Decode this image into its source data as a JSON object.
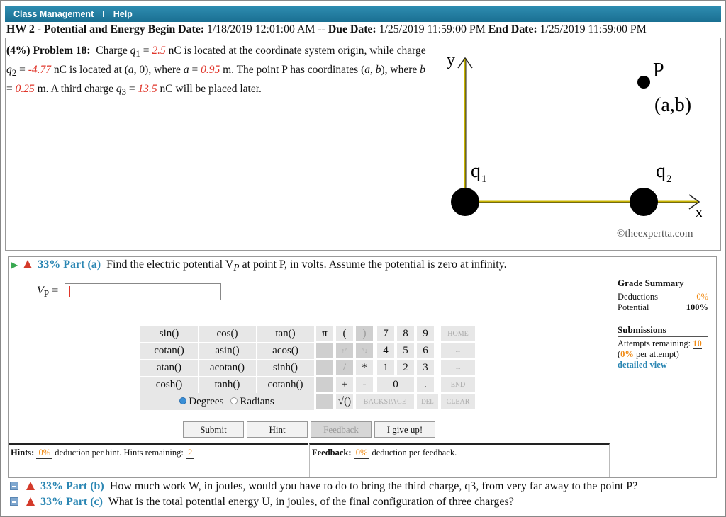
{
  "topbar": {
    "class_management": "Class Management",
    "separator": "I",
    "help": "Help"
  },
  "hw": {
    "title": "HW 2 - Potential and Energy",
    "begin_label": "Begin Date:",
    "begin_value": "1/18/2019 12:01:00 AM --",
    "due_label": "Due Date:",
    "due_value": "1/25/2019 11:59:00 PM",
    "end_label": "End Date:",
    "end_value": "1/25/2019 11:59:00 PM"
  },
  "problem": {
    "header": "(4%)  Problem 18:",
    "q1": "2.5",
    "q2": "-4.77",
    "a": "0.95",
    "b": "0.25",
    "q3": "13.5"
  },
  "figure": {
    "y_label": "y",
    "x_label": "x",
    "p_label": "P",
    "ab_label": "(a,b)",
    "q1_label": "q",
    "q1_sub": "1",
    "q2_label": "q",
    "q2_sub": "2",
    "credit": "©theexpertta.com"
  },
  "part_a": {
    "percent": "33% Part (a)",
    "question": "Find the electric potential V",
    "question_sub": "P",
    "question_rest": " at point P, in volts. Assume the potential is zero at infinity.",
    "answer_label": "V",
    "answer_sub": "P",
    "answer_eq": " =",
    "answer_value": ""
  },
  "calculator": {
    "functions": [
      [
        "sin()",
        "cos()",
        "tan()"
      ],
      [
        "cotan()",
        "asin()",
        "acos()"
      ],
      [
        "atan()",
        "acotan()",
        "sinh()"
      ],
      [
        "cosh()",
        "tanh()",
        "cotanh()"
      ]
    ],
    "degrees": "Degrees",
    "radians": "Radians",
    "angle_mode": "Degrees",
    "keys": {
      "pi": "π",
      "lparen": "(",
      "rparen": ")",
      "up": "↑^",
      "down": "^↓",
      "slash": "/",
      "star": "*",
      "plus": "+",
      "minus": "-",
      "sqrt": "√()",
      "n7": "7",
      "n8": "8",
      "n9": "9",
      "n4": "4",
      "n5": "5",
      "n6": "6",
      "n1": "1",
      "n2": "2",
      "n3": "3",
      "n0": "0",
      "dot": ".",
      "home": "HOME",
      "left": "←",
      "right": "→",
      "end": "END",
      "backspace": "BACKSPACE",
      "del": "DEL",
      "clear": "CLEAR"
    }
  },
  "buttons": {
    "submit": "Submit",
    "hint": "Hint",
    "feedback": "Feedback",
    "give_up": "I give up!"
  },
  "grade": {
    "title": "Grade Summary",
    "deductions_label": "Deductions",
    "deductions_value": "0%",
    "potential_label": "Potential",
    "potential_value": "100%",
    "submissions_title": "Submissions",
    "attempts_label": "Attempts remaining:",
    "attempts_value": "10",
    "per_attempt_open": "(",
    "per_attempt_value": "0%",
    "per_attempt_text": " per attempt)",
    "detailed_view": "detailed view"
  },
  "hints": {
    "label": "Hints:",
    "deduction": "0%",
    "text": "deduction per hint. Hints remaining:",
    "remaining": "2"
  },
  "feedback": {
    "label": "Feedback:",
    "deduction": "0%",
    "text": "deduction per feedback."
  },
  "part_b": {
    "percent": "33% Part (b)",
    "question": "How much work W, in joules, would you have to do to bring the third charge, q3, from very far away to the point P?"
  },
  "part_c": {
    "percent": "33% Part (c)",
    "question": "What is the total potential energy U, in joules, of the final configuration of three charges?"
  },
  "colors": {
    "topbar": "#1a6f92",
    "part_label": "#2a86b3",
    "value_red": "#e0352a",
    "orange": "#f08a14",
    "axis_yellow": "#c8b400"
  }
}
